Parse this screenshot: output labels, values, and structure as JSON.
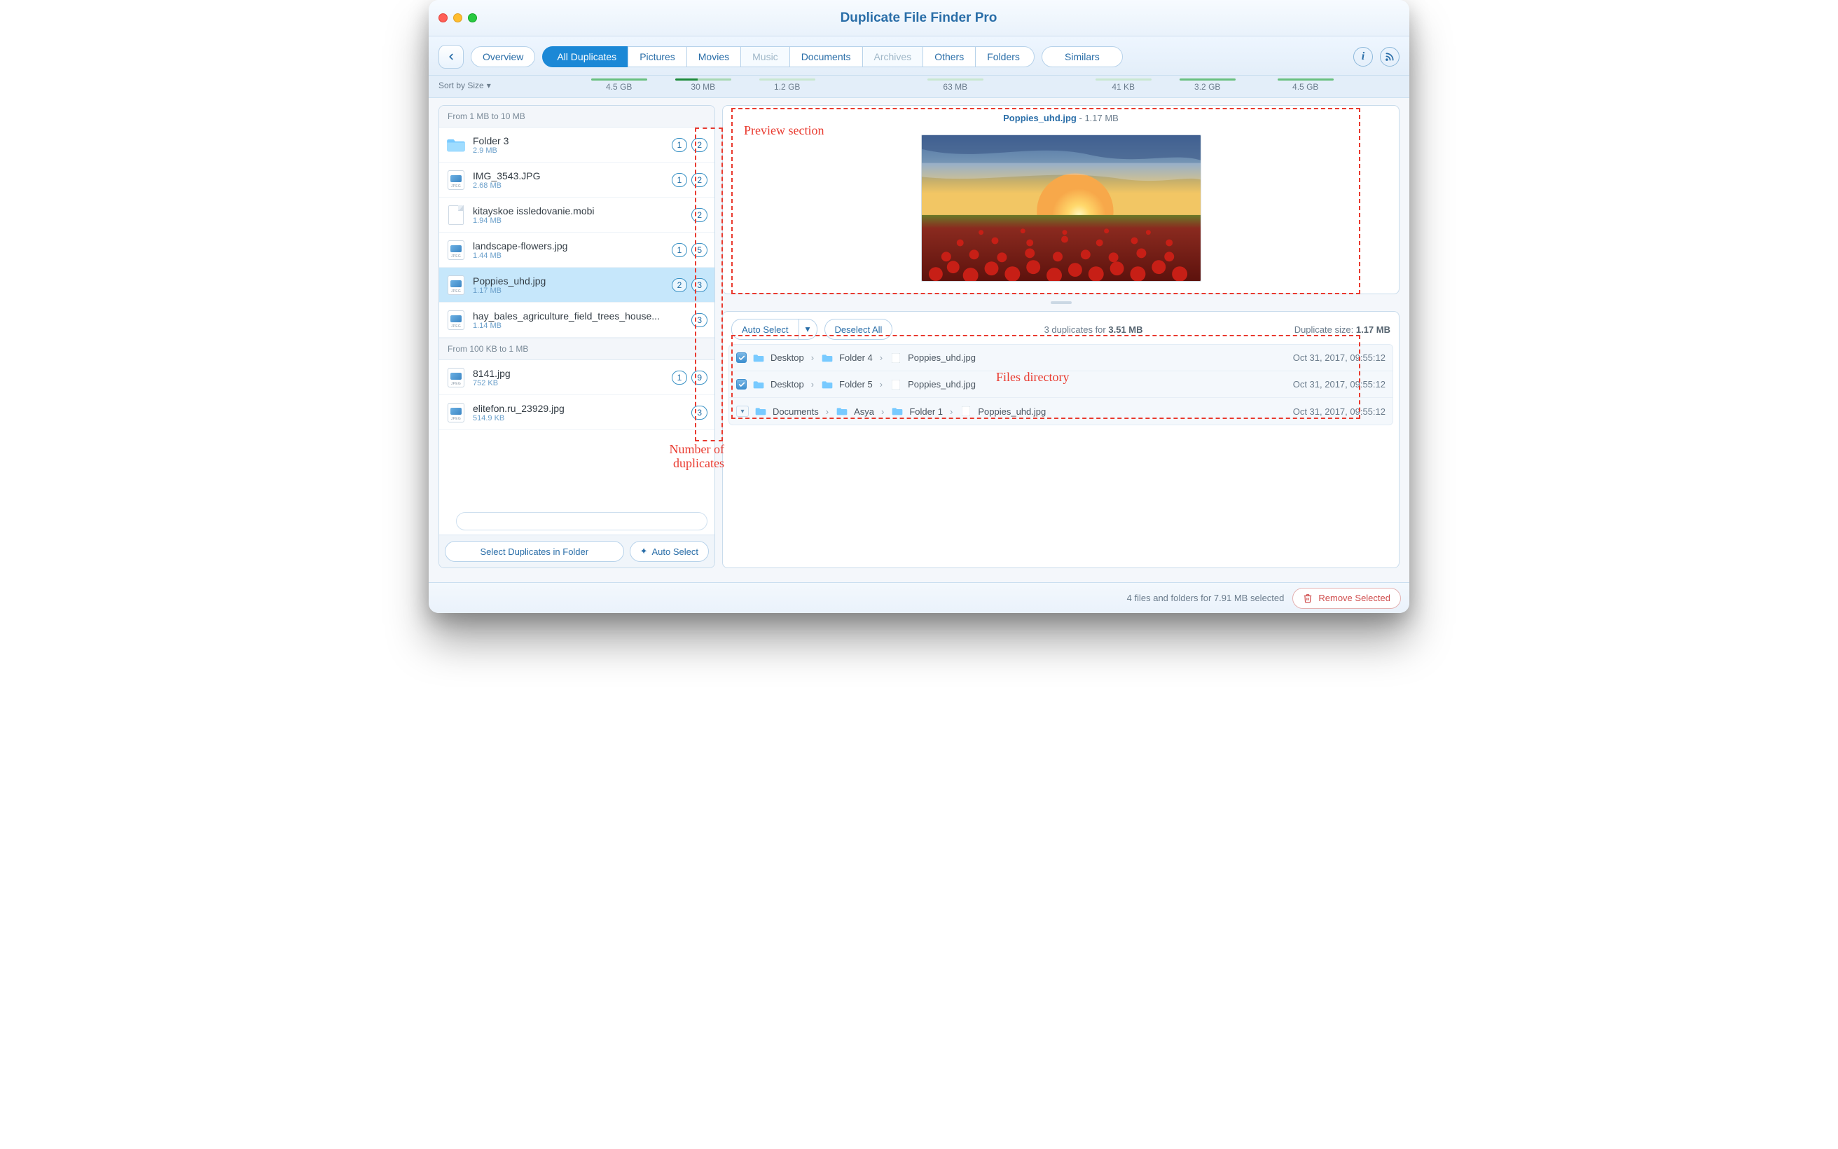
{
  "window": {
    "title": "Duplicate File Finder Pro"
  },
  "toolbar": {
    "tabs": [
      {
        "label": "Overview"
      },
      {
        "label": "All Duplicates"
      },
      {
        "label": "Pictures"
      },
      {
        "label": "Movies"
      },
      {
        "label": "Music"
      },
      {
        "label": "Documents"
      },
      {
        "label": "Archives"
      },
      {
        "label": "Others"
      },
      {
        "label": "Folders"
      },
      {
        "label": "Similars"
      }
    ]
  },
  "sort": {
    "label": "Sort by Size"
  },
  "sizes": [
    "4.5 GB",
    "30 MB",
    "1.2 GB",
    "63 MB",
    "41 KB",
    "3.2 GB",
    "4.5 GB"
  ],
  "left": {
    "search_placeholder": "",
    "sections": [
      {
        "title": "From 1 MB to 10 MB",
        "items": [
          {
            "name": "Folder 3",
            "size": "2.9 MB",
            "sel": "1",
            "dup": "2"
          },
          {
            "name": "IMG_3543.JPG",
            "size": "2.68 MB",
            "sel": "1",
            "dup": "2"
          },
          {
            "name": "kitayskoe issledovanie.mobi",
            "size": "1.94 MB",
            "dup": "2"
          },
          {
            "name": "landscape-flowers.jpg",
            "size": "1.44 MB",
            "sel": "1",
            "dup": "5"
          },
          {
            "name": "Poppies_uhd.jpg",
            "size": "1.17 MB",
            "sel": "2",
            "dup": "3"
          },
          {
            "name": "hay_bales_agriculture_field_trees_house...",
            "size": "1.14 MB",
            "dup": "3"
          }
        ]
      },
      {
        "title": "From 100 KB to 1 MB",
        "items": [
          {
            "name": "8141.jpg",
            "size": "752 KB",
            "sel": "1",
            "dup": "9"
          },
          {
            "name": "elitefon.ru_23929.jpg",
            "size": "514.9 KB",
            "dup": "3"
          }
        ]
      }
    ],
    "footer": {
      "select_in_folder": "Select Duplicates in Folder",
      "auto_select": "Auto Select"
    }
  },
  "preview": {
    "filename": "Poppies_uhd.jpg",
    "size_display": "- 1.17 MB"
  },
  "details": {
    "auto_select": "Auto Select",
    "deselect_all": "Deselect All",
    "summary_prefix": "3 duplicates for",
    "summary_size": "3.51 MB",
    "dup_size_label": "Duplicate size:",
    "dup_size_value": "1.17 MB",
    "rows": [
      {
        "checked": true,
        "path": [
          "Desktop",
          "Folder 4",
          "Poppies_uhd.jpg"
        ],
        "ts": "Oct 31, 2017, 09:55:12"
      },
      {
        "checked": true,
        "path": [
          "Desktop",
          "Folder 5",
          "Poppies_uhd.jpg"
        ],
        "ts": "Oct 31, 2017, 09:55:12"
      },
      {
        "checked": false,
        "path": [
          "Documents",
          "Asya",
          "Folder 1",
          "Poppies_uhd.jpg"
        ],
        "ts": "Oct 31, 2017, 09:55:12"
      }
    ]
  },
  "status": {
    "text": "4 files and folders for 7.91 MB selected",
    "remove_label": "Remove Selected"
  },
  "annotations": {
    "preview": "Preview section",
    "dup_count": "Number of duplicates",
    "files_dir": "Files directory"
  }
}
